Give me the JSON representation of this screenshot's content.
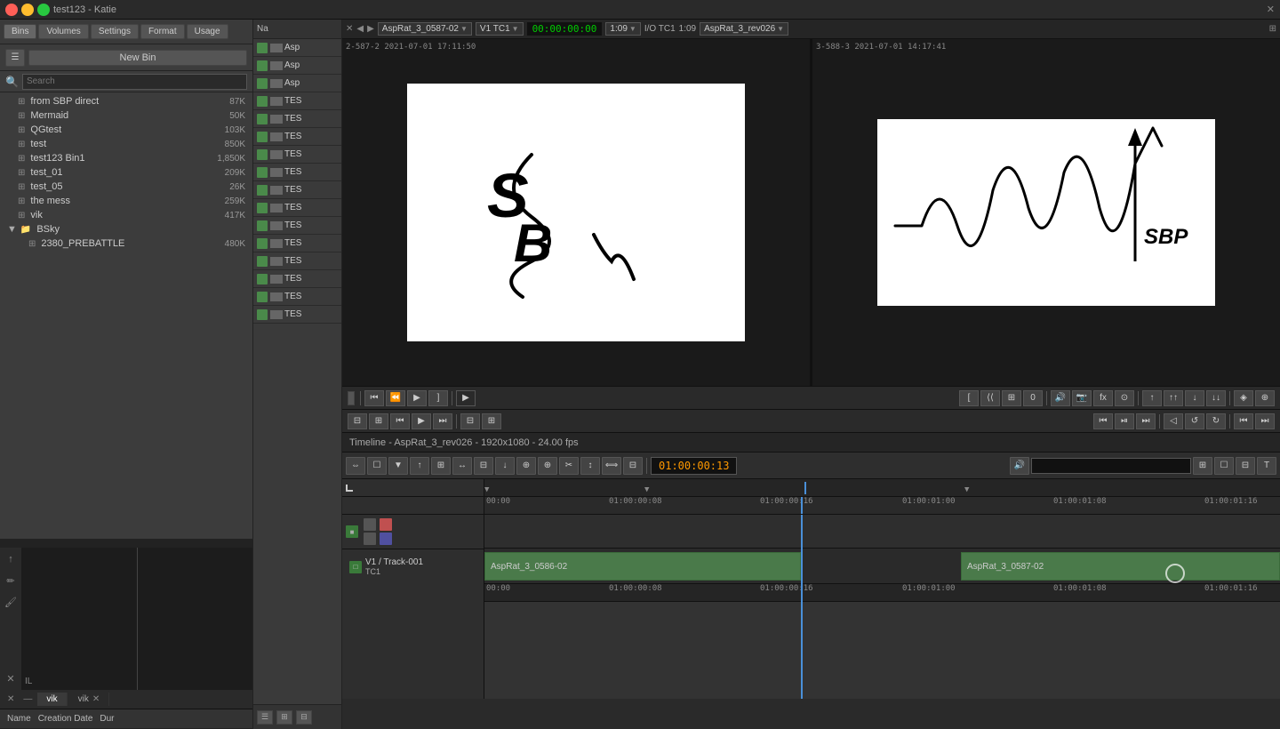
{
  "window": {
    "title": "test123 - Katie"
  },
  "nav": {
    "bins_label": "Bins",
    "volumes_label": "Volumes",
    "settings_label": "Settings",
    "format_label": "Format",
    "usage_label": "Usage"
  },
  "left_toolbar": {
    "new_bin_label": "New Bin"
  },
  "bins": [
    {
      "name": "from SBP direct",
      "size": "87K",
      "indent": 1
    },
    {
      "name": "Mermaid",
      "size": "50K",
      "indent": 1
    },
    {
      "name": "QGtest",
      "size": "103K",
      "indent": 1
    },
    {
      "name": "test",
      "size": "850K",
      "indent": 1
    },
    {
      "name": "test123 Bin1",
      "size": "1,850K",
      "indent": 1
    },
    {
      "name": "test_01",
      "size": "209K",
      "indent": 1
    },
    {
      "name": "test_05",
      "size": "26K",
      "indent": 1
    },
    {
      "name": "the mess",
      "size": "259K",
      "indent": 1
    },
    {
      "name": "vik",
      "size": "417K",
      "indent": 1
    },
    {
      "name": "BSky",
      "size": "",
      "indent": 0,
      "expanded": true
    },
    {
      "name": "2380_PREBATTLE",
      "size": "480K",
      "indent": 2
    }
  ],
  "bin_panel": {
    "col_name": "Na",
    "rows": [
      {
        "color": "#4a8a4a",
        "name": "Asp"
      },
      {
        "color": "#4a8a4a",
        "name": "Asp"
      },
      {
        "color": "#4a8a4a",
        "name": "Asp"
      },
      {
        "color": "#4a8a4a",
        "name": "TES"
      },
      {
        "color": "#4a8a4a",
        "name": "TES"
      },
      {
        "color": "#4a8a4a",
        "name": "TES"
      },
      {
        "color": "#4a8a4a",
        "name": "TES"
      },
      {
        "color": "#4a8a4a",
        "name": "TES"
      },
      {
        "color": "#4a8a4a",
        "name": "TES"
      },
      {
        "color": "#4a8a4a",
        "name": "TES"
      },
      {
        "color": "#4a8a4a",
        "name": "TES"
      },
      {
        "color": "#4a8a4a",
        "name": "TES"
      },
      {
        "color": "#4a8a4a",
        "name": "TES"
      },
      {
        "color": "#4a8a4a",
        "name": "TES"
      },
      {
        "color": "#4a8a4a",
        "name": "TES"
      },
      {
        "color": "#4a8a4a",
        "name": "TES"
      }
    ]
  },
  "viewer": {
    "clip_name": "AspRat_3_0587-02",
    "tc_mode": "V1  TC1",
    "timecode": "00:00:00:00",
    "ratio": "1:09",
    "io_label": "I/O  TC1",
    "io_value": "1:09",
    "rev_label": "AspRat_3_rev026",
    "meta_left": "2-587-2 2021-07-01  17:11:50",
    "meta_right": "3-588-3 2021-07-01  14:17:41"
  },
  "vik_tabs": [
    {
      "label": "vik",
      "closable": false
    },
    {
      "label": "vik",
      "closable": true
    }
  ],
  "bin_columns": {
    "name": "Name",
    "creation_date": "Creation Date",
    "dur": "Dur"
  },
  "timeline": {
    "title": "Timeline - AspRat_3_rev026 - 1920x1080 - 24.00 fps",
    "timecode": "01:00:00:13",
    "track_name": "V1",
    "track_label": "V1 / Track-001",
    "track_tc": "TC1",
    "clip1_name": "AspRat_3_0586-02",
    "clip2_name": "AspRat_3_0587-02",
    "ruler_marks": [
      "00:00",
      "01:00:00:08",
      "01:00:00:16",
      "01:00:01:00",
      "01:00:01:08",
      "01:00:01:16"
    ],
    "clip1_tc_start": "00:00",
    "clip1_tc_end": "01:00:00:08",
    "clip2_tc_start": "01:00:00:16",
    "clip2_tc_end": "01:00:01:00"
  },
  "il_label": "IL",
  "colors": {
    "accent": "#4a90d9",
    "green": "#4a8a4a",
    "timecode": "#00cc00",
    "orange_tc": "#f90"
  }
}
